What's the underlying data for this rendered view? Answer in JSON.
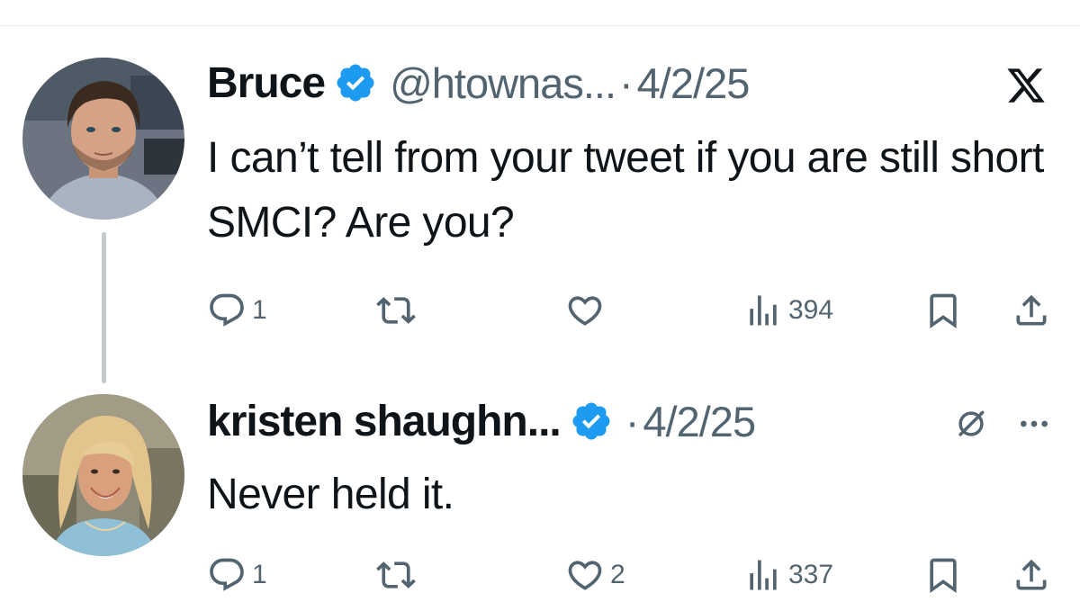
{
  "thread": [
    {
      "author": {
        "name": "Bruce",
        "handle": "@htownas...",
        "verified": true,
        "avatar": "man-portrait-avatar"
      },
      "separator": "·",
      "date": "4/2/25",
      "corner_icon": "x-logo-icon",
      "text": "I can’t tell from your tweet if you are still short SMCI? Are you?",
      "metrics": {
        "replies": "1",
        "reposts": "",
        "likes": "",
        "views": "394"
      }
    },
    {
      "author": {
        "name": "kristen shaughn...",
        "verified": true,
        "avatar": "woman-portrait-avatar"
      },
      "separator": "·",
      "date": "4/2/25",
      "corner_icons": [
        "grok-icon",
        "more-icon"
      ],
      "text": "Never held it.",
      "metrics": {
        "replies": "1",
        "reposts": "",
        "likes": "2",
        "views": "337"
      }
    }
  ],
  "colors": {
    "text_primary": "#0f1419",
    "text_secondary": "#536471",
    "verified_blue": "#1d9bf0",
    "thread_line": "#c4c9cd"
  }
}
